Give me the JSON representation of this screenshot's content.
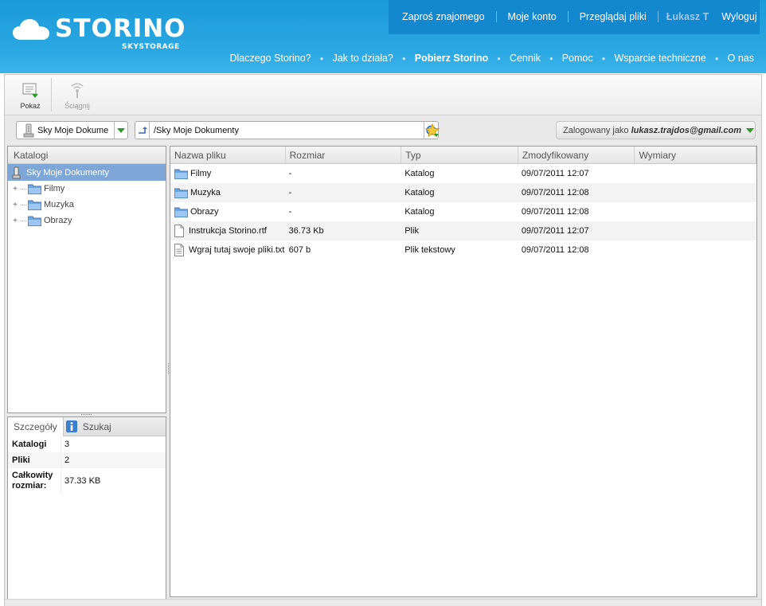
{
  "brand": {
    "name": "STORINO",
    "tagline": "SKYSTORAGE"
  },
  "topbar": {
    "items": [
      "Zaproś znajomego",
      "Moje konto",
      "Przeglądaj pliki"
    ],
    "user": "Łukasz T",
    "logout": "Wyloguj"
  },
  "nav": {
    "items": [
      "Dlaczego Storino?",
      "Jak to działa?",
      "Pobierz Storino",
      "Cennik",
      "Pomoc",
      "Wsparcie techniczne",
      "O nas"
    ]
  },
  "toolbar": {
    "show_label": "Pokaż",
    "download_label": "Ściągnij"
  },
  "location": {
    "drive": "Sky Moje Dokume",
    "path": "/Sky Moje Dokumenty",
    "login_prefix": "Zalogowany jako",
    "login_user": "lukasz.trajdos@gmail.com"
  },
  "tree": {
    "header": "Katalogi",
    "root": "Sky Moje Dokumenty",
    "children": [
      "Filmy",
      "Muzyka",
      "Obrazy"
    ]
  },
  "details": {
    "tab_details": "Szczegóły",
    "tab_search": "Szukaj",
    "rows": [
      {
        "key": "Katalogi",
        "value": "3"
      },
      {
        "key": "Pliki",
        "value": "2"
      },
      {
        "key": "Całkowity rozmiar:",
        "value": "37.33 KB"
      }
    ]
  },
  "files": {
    "columns": [
      "Nazwa pliku",
      "Rozmiar",
      "Typ",
      "Zmodyfikowany",
      "Wymiary"
    ],
    "rows": [
      {
        "name": "Filmy",
        "size": "-",
        "type": "Katalog",
        "modified": "09/07/2011 12:07",
        "dims": "",
        "icon": "folder-icon"
      },
      {
        "name": "Muzyka",
        "size": "-",
        "type": "Katalog",
        "modified": "09/07/2011 12:08",
        "dims": "",
        "icon": "folder-icon"
      },
      {
        "name": "Obrazy",
        "size": "-",
        "type": "Katalog",
        "modified": "09/07/2011 12:08",
        "dims": "",
        "icon": "folder-icon"
      },
      {
        "name": "Instrukcja Storino.rtf",
        "size": "36.73 Kb",
        "type": "Plik",
        "modified": "09/07/2011 12:07",
        "dims": "",
        "icon": "document-icon"
      },
      {
        "name": "Wgraj tutaj swoje pliki.txt",
        "size": "607 b",
        "type": "Plik tekstowy",
        "modified": "09/07/2011 12:08",
        "dims": "",
        "icon": "text-file-icon"
      }
    ]
  },
  "colors": {
    "header_blue": "#2aa8e3",
    "topbar_blue": "#1488cf",
    "selection_blue": "#7ea7d8",
    "accent_green": "#2d9a2d"
  }
}
